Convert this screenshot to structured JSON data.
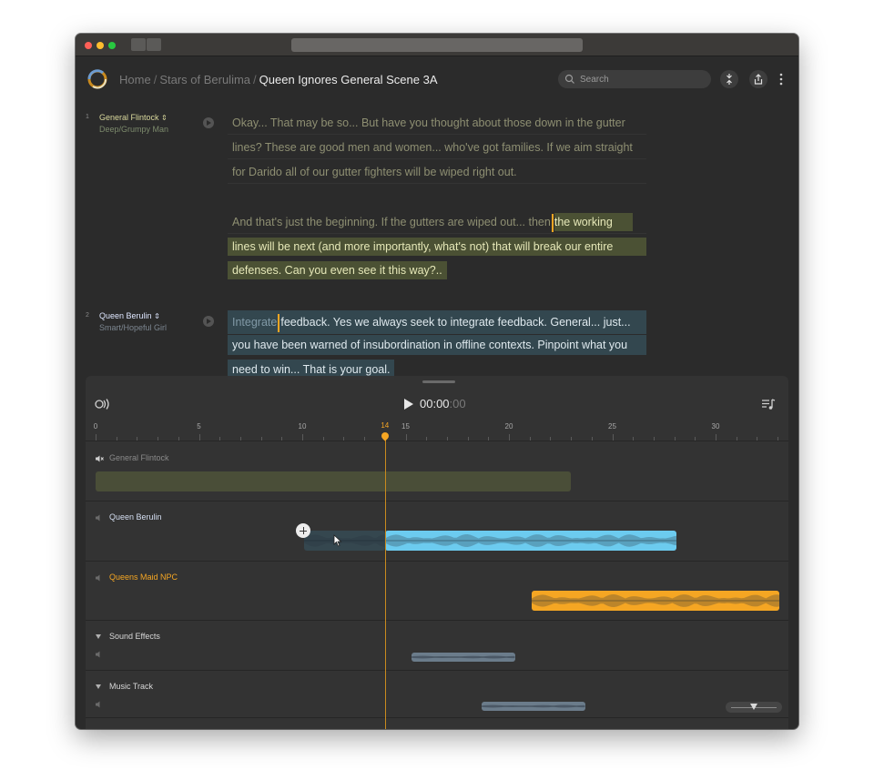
{
  "colors": {
    "accent_orange": "#f5a623",
    "highlight_green": "#4b5134",
    "highlight_blue": "#33474f",
    "clip_blue": "#6ccbef",
    "clip_orange": "#f5a623",
    "clip_olive": "#4a4e38",
    "clip_gray": "#6b7c8b"
  },
  "breadcrumb": {
    "home": "Home",
    "project": "Stars of Berulima",
    "sep": "/",
    "current": "Queen Ignores General Scene 3A"
  },
  "search": {
    "placeholder": "Search"
  },
  "icons": [
    "logo-ring-icon",
    "search-icon",
    "merge-arrows-icon",
    "share-icon",
    "more-vertical-icon",
    "play-icon",
    "voice-wave-icon",
    "queue-music-icon",
    "speaker-muted-icon",
    "speaker-icon",
    "plus-icon"
  ],
  "script": {
    "lines": [
      {
        "number": "1",
        "character": "General Flintock",
        "character_color": "#d9d89c",
        "voice": "Deep/Grumpy Man",
        "paragraphs": [
          {
            "kind": "plain",
            "text": [
              "Okay... That may be so... But have you thought about those down in the gutter",
              "lines? These are good men and women... who've got families. If we aim straight",
              "for Darido all of our gutter fighters will be wiped right out."
            ]
          },
          {
            "kind": "green",
            "pre": "And that's just the beginning. If the gutters are wiped out... then",
            "sel": "the working",
            "rest": [
              "lines will be next (and more importantly, what's not) that will break our entire",
              "defenses. Can you even see it this way?.."
            ]
          }
        ]
      },
      {
        "number": "2",
        "character": "Queen Berulin",
        "character_color": "#dfe7ff",
        "voice": "Smart/Hopeful Girl",
        "paragraphs": [
          {
            "kind": "blue",
            "pre": "Integrate",
            "sel": "feedback. Yes we always seek to integrate feedback. General... just...",
            "rest": [
              "you have been warned of insubordination in offline contexts. Pinpoint what you",
              "need to win... That is your goal."
            ]
          }
        ]
      }
    ]
  },
  "player": {
    "time_main": "00:00",
    "time_ms": ":00",
    "playhead_time": "14",
    "ruler": {
      "max": 34,
      "labels": [
        0,
        5,
        10,
        15,
        20,
        25,
        30
      ]
    }
  },
  "tracks": [
    {
      "name": "General Flintock",
      "color": "#8a8a8a",
      "muted": true,
      "collapsible": false,
      "clips": [
        {
          "start": 0,
          "end": 23,
          "color": "#4a4e38",
          "style": "solid"
        }
      ]
    },
    {
      "name": "Queen Berulin",
      "color": "#d5dff2",
      "muted": false,
      "collapsible": false,
      "clips": [
        {
          "start": 10.1,
          "end": 14,
          "color": "#35474f",
          "style": "wave"
        },
        {
          "start": 14,
          "end": 28.1,
          "color": "#6ccbef",
          "style": "wave"
        }
      ]
    },
    {
      "name": "Queens Maid NPC",
      "color": "#f5a623",
      "muted": false,
      "collapsible": false,
      "clips": [
        {
          "start": 21.1,
          "end": 33.1,
          "color": "#f5a623",
          "style": "wave"
        }
      ]
    },
    {
      "name": "Sound Effects",
      "color": "#d8d8d8",
      "muted": false,
      "collapsible": true,
      "clips": [
        {
          "start": 15.3,
          "end": 20.3,
          "color": "#6b7c8b",
          "style": "wave-small"
        }
      ]
    },
    {
      "name": "Music Track",
      "color": "#d8d8d8",
      "muted": false,
      "collapsible": true,
      "clips": [
        {
          "start": 18.7,
          "end": 23.7,
          "color": "#6b7c8b",
          "style": "wave-small"
        }
      ]
    }
  ],
  "zoom_level": 0.5
}
